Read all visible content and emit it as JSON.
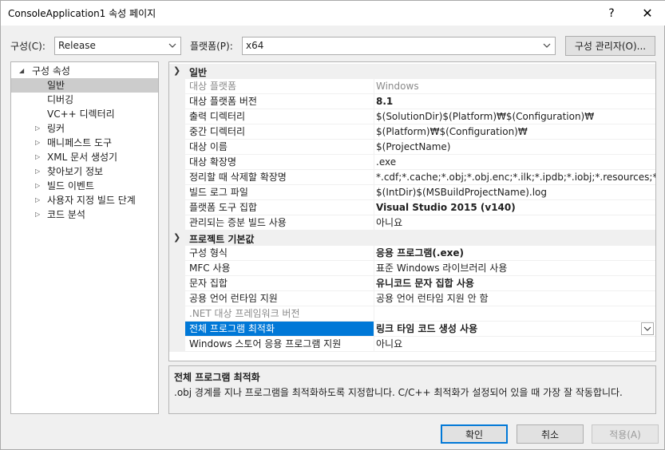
{
  "window": {
    "title": "ConsoleApplication1 속성 페이지",
    "help_glyph": "?",
    "close_glyph": "✕"
  },
  "config_bar": {
    "config_label": "구성(C):",
    "config_value": "Release",
    "platform_label": "플랫폼(P):",
    "platform_value": "x64",
    "manager_button": "구성 관리자(O)..."
  },
  "tree": {
    "root": "구성 속성",
    "items": [
      {
        "label": "일반"
      },
      {
        "label": "디버깅"
      },
      {
        "label": "VC++ 디렉터리"
      },
      {
        "label": "링커"
      },
      {
        "label": "매니페스트 도구"
      },
      {
        "label": "XML 문서 생성기"
      },
      {
        "label": "찾아보기 정보"
      },
      {
        "label": "빌드 이벤트"
      },
      {
        "label": "사용자 지정 빌드 단계"
      },
      {
        "label": "코드 분석"
      }
    ]
  },
  "grid": {
    "categories": [
      {
        "label": "일반"
      },
      {
        "label": "프로젝트 기본값"
      }
    ],
    "general_rows": [
      {
        "name": "대상 플랫폼",
        "value": "Windows"
      },
      {
        "name": "대상 플랫폼 버전",
        "value": "8.1"
      },
      {
        "name": "출력 디렉터리",
        "value": "$(SolutionDir)$(Platform)₩$(Configuration)₩"
      },
      {
        "name": "중간 디렉터리",
        "value": "$(Platform)₩$(Configuration)₩"
      },
      {
        "name": "대상 이름",
        "value": "$(ProjectName)"
      },
      {
        "name": "대상 확장명",
        "value": ".exe"
      },
      {
        "name": "정리할 때 삭제할 확장명",
        "value": "*.cdf;*.cache;*.obj;*.obj.enc;*.ilk;*.ipdb;*.iobj;*.resources;*.tlb;*.tli;*."
      },
      {
        "name": "빌드 로그 파일",
        "value": "$(IntDir)$(MSBuildProjectName).log"
      },
      {
        "name": "플랫폼 도구 집합",
        "value": "Visual Studio 2015 (v140)"
      },
      {
        "name": "관리되는 증분 빌드 사용",
        "value": "아니요"
      }
    ],
    "defaults_rows": [
      {
        "name": "구성 형식",
        "value": "응용 프로그램(.exe)"
      },
      {
        "name": "MFC 사용",
        "value": "표준 Windows 라이브러리 사용"
      },
      {
        "name": "문자 집합",
        "value": "유니코드 문자 집합 사용"
      },
      {
        "name": "공용 언어 런타임 지원",
        "value": "공용 언어 런타임 지원 안 함"
      },
      {
        "name": ".NET 대상 프레임워크 버전",
        "value": ""
      },
      {
        "name": "전체 프로그램 최적화",
        "value": "링크 타임 코드 생성 사용"
      },
      {
        "name": "Windows 스토어 응용 프로그램 지원",
        "value": "아니요"
      }
    ]
  },
  "description": {
    "title": "전체 프로그램 최적화",
    "text": ".obj 경계를 지나 프로그램을 최적화하도록 지정합니다. C/C++ 최적화가 설정되어 있을 때 가장 잘 작동합니다."
  },
  "buttons": {
    "ok": "확인",
    "cancel": "취소",
    "apply": "적용(A)"
  },
  "colors": {
    "selection": "#0078d7",
    "tree_selection": "#cccccc",
    "disabled_text": "#8a8a8a"
  }
}
